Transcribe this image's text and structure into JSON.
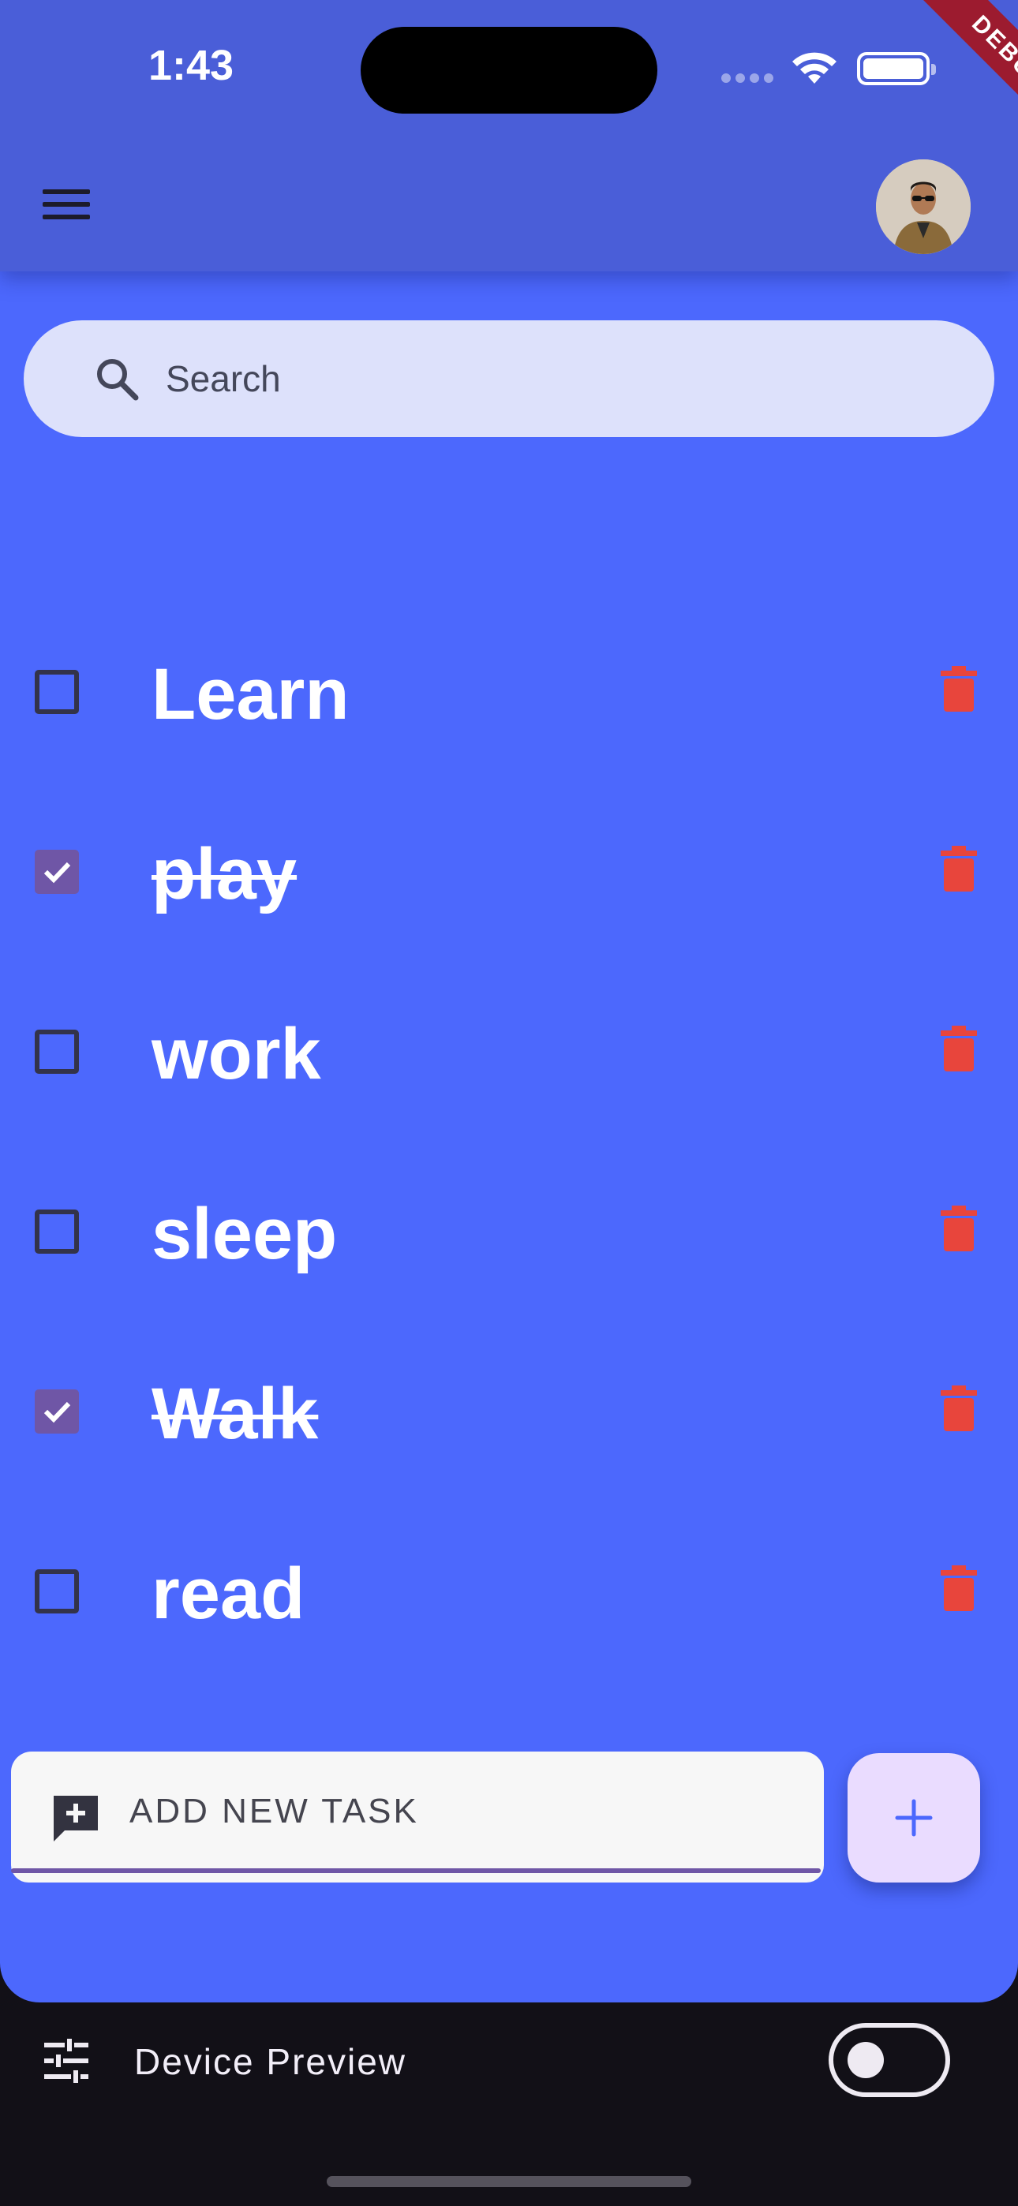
{
  "status_bar": {
    "time": "1:43"
  },
  "debug_banner": "DEBUG",
  "search": {
    "placeholder": "Search"
  },
  "tasks": [
    {
      "label": "Learn",
      "done": false
    },
    {
      "label": "play",
      "done": true
    },
    {
      "label": "work",
      "done": false
    },
    {
      "label": "sleep",
      "done": false
    },
    {
      "label": "Walk",
      "done": true
    },
    {
      "label": "read",
      "done": false
    }
  ],
  "add_task": {
    "placeholder": "ADD NEW TASK",
    "fab_icon": "plus-icon"
  },
  "device_preview": {
    "label": "Device Preview",
    "toggle_on": false
  },
  "colors": {
    "background": "#4c68fd",
    "app_bar": "#4a5ed8",
    "delete": "#e8453c",
    "checked": "#6f56a6",
    "fab": "#eadcff"
  }
}
